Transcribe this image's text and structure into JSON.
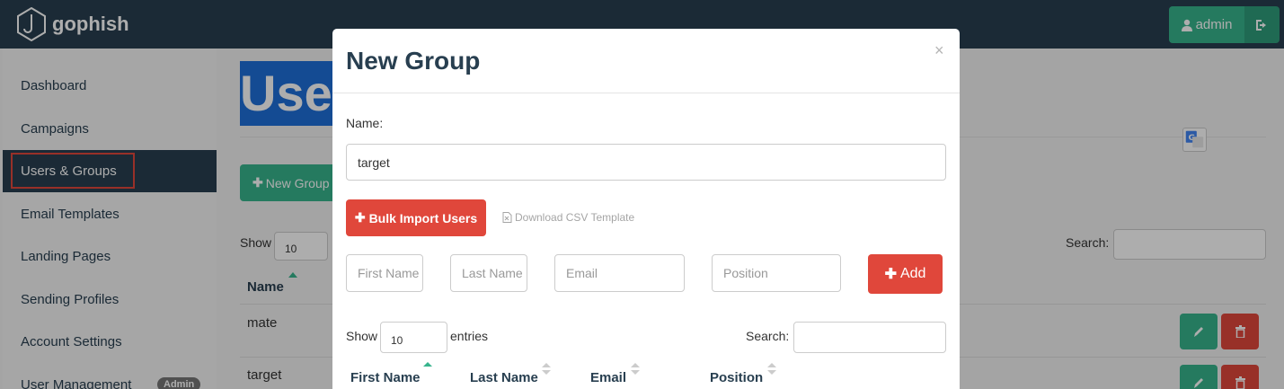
{
  "navbar": {
    "brand": "gophish",
    "user_label": "admin"
  },
  "sidebar": {
    "items": [
      {
        "label": "Dashboard"
      },
      {
        "label": "Campaigns"
      },
      {
        "label": "Users & Groups"
      },
      {
        "label": "Email Templates"
      },
      {
        "label": "Landing Pages"
      },
      {
        "label": "Sending Profiles"
      },
      {
        "label": "Account Settings"
      },
      {
        "label": "User Management",
        "badge": "Admin"
      }
    ],
    "active": "Users & Groups"
  },
  "page": {
    "title": "Users & Groups",
    "new_group_label": "New Group",
    "show_label": "Show",
    "length_value": "10",
    "search_label": "Search:",
    "column_name": "Name",
    "rows": [
      "mate",
      "target"
    ]
  },
  "modal": {
    "title": "New Group",
    "close_glyph": "×",
    "name_label": "Name:",
    "name_value": "target",
    "bulk_import_label": "Bulk Import Users",
    "csv_label": "Download CSV Template",
    "first_name_placeholder": "First Name",
    "last_name_placeholder": "Last Name",
    "email_placeholder": "Email",
    "position_placeholder": "Position",
    "add_label": "Add",
    "show_label": "Show",
    "length_value": "10",
    "entries_label": "entries",
    "search_label": "Search:",
    "columns": [
      "First Name",
      "Last Name",
      "Email",
      "Position"
    ]
  },
  "colors": {
    "navbar": "#283f50",
    "accent_green": "#37b48d",
    "danger_red": "#e0473b",
    "title_highlight": "#1e6fd9"
  },
  "icons": [
    "gophish-logo-icon",
    "user-icon",
    "logout-icon",
    "plus-icon",
    "file-excel-icon",
    "pencil-icon",
    "trash-icon",
    "sort-asc-icon",
    "sort-icon",
    "google-translate-icon"
  ]
}
